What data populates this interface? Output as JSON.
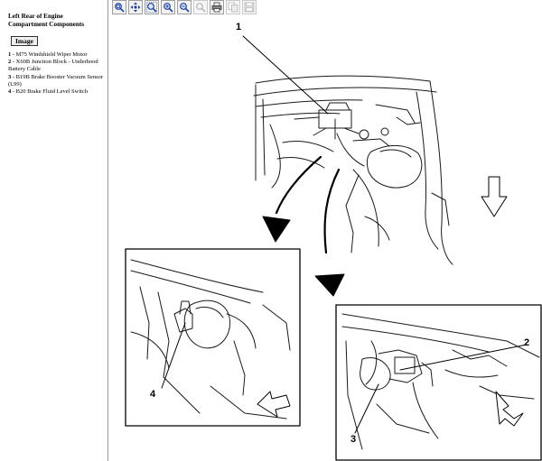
{
  "left_pane": {
    "title": "Left Rear of Engine Compartment Components",
    "image_button": "Image",
    "legend": [
      {
        "num": "1",
        "text": " - M75 Windshield Wiper Motor"
      },
      {
        "num": "2",
        "text": " - X60B Junction Block - Underhood Battery Cable"
      },
      {
        "num": "3",
        "text": " - B19B Brake Booster Vacuum Sensor (L99)"
      },
      {
        "num": "4",
        "text": " - B20 Brake Fluid Level Switch"
      }
    ]
  },
  "toolbar": {
    "buttons": [
      {
        "icon": "zoom-fit-icon",
        "enabled": true
      },
      {
        "icon": "pan-icon",
        "enabled": true
      },
      {
        "icon": "zoom-area-icon",
        "enabled": true
      },
      {
        "icon": "zoom-in-icon",
        "enabled": true
      },
      {
        "icon": "zoom-out-icon",
        "enabled": true
      },
      {
        "icon": "zoom-reset-icon",
        "enabled": false
      },
      {
        "icon": "print-icon",
        "enabled": true
      },
      {
        "icon": "copy-icon",
        "enabled": false
      },
      {
        "icon": "save-icon",
        "enabled": false
      }
    ]
  },
  "diagram": {
    "callouts": [
      "1",
      "2",
      "3",
      "4"
    ]
  }
}
